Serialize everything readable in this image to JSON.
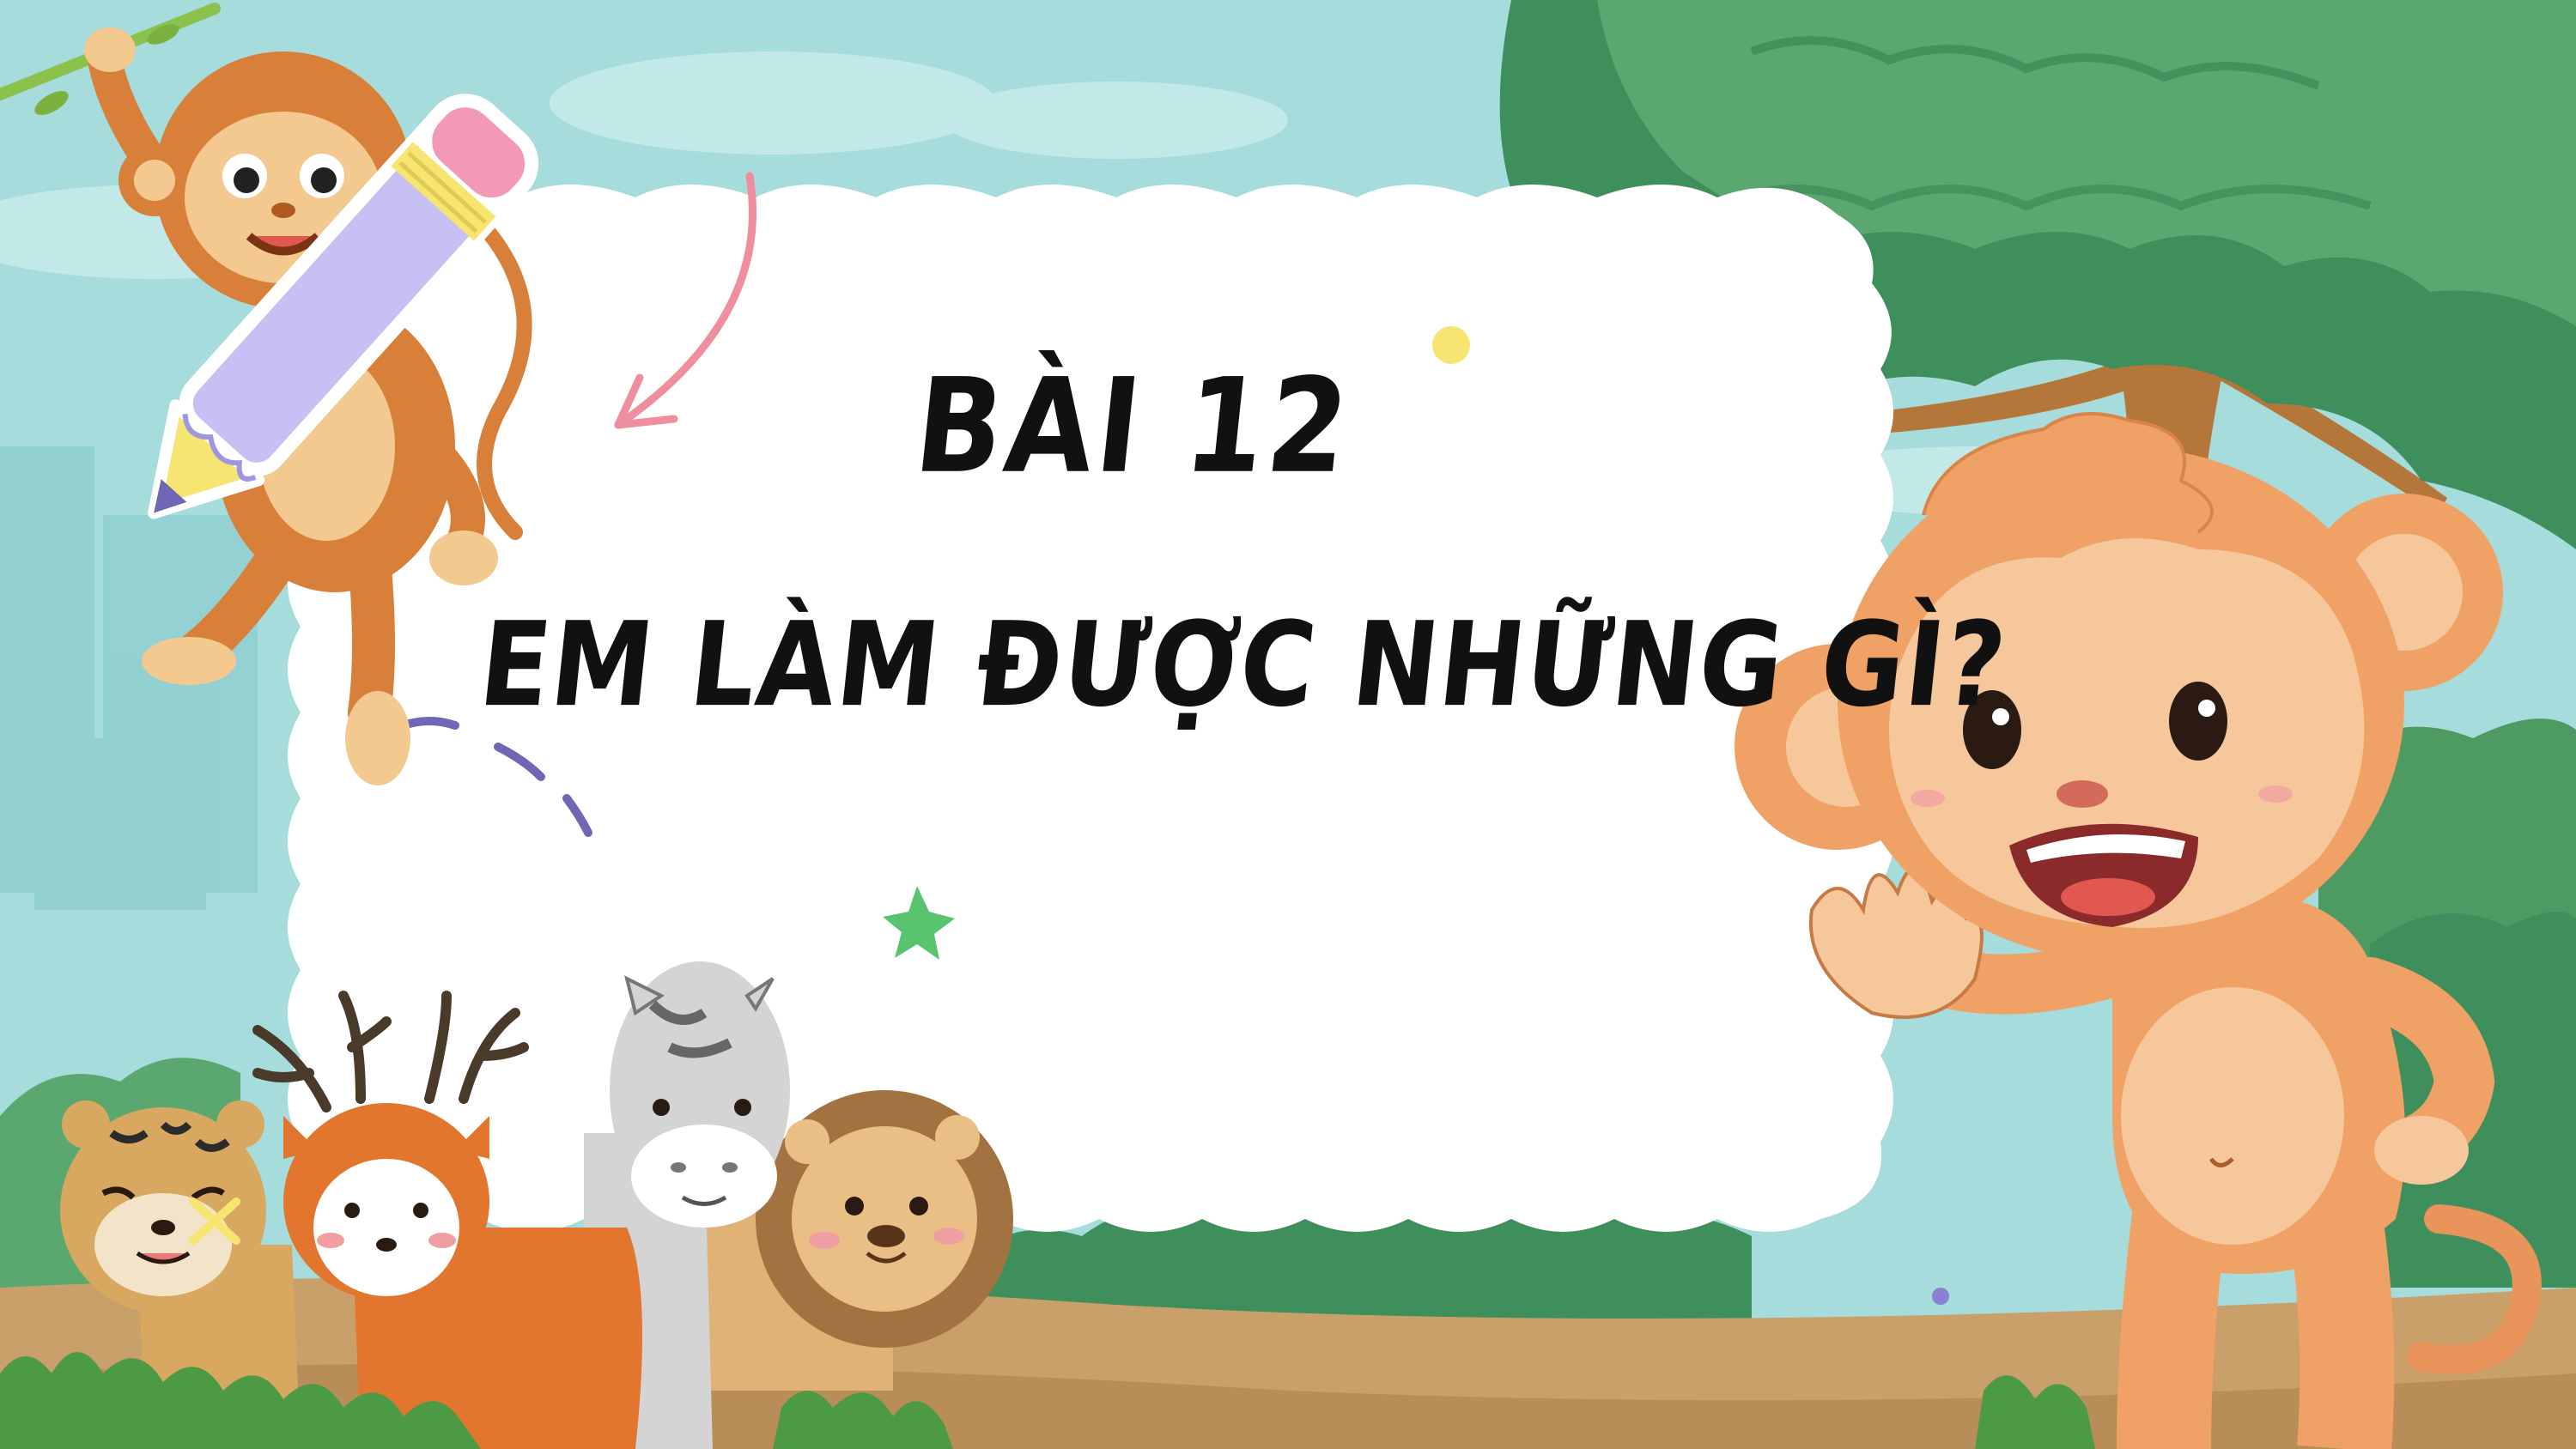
{
  "slide": {
    "lesson_number": "BÀI 12",
    "lesson_title": "EM LÀM ĐƯỢC NHỮNG GÌ?"
  },
  "colors": {
    "sky": "#a6dcdb",
    "tree_dark": "#3f8f5c",
    "tree_light": "#5aa86f",
    "trunk": "#b5763a",
    "ground": "#c9a06a",
    "cloud": "#ffffff",
    "monkey_big": "#f0a266",
    "monkey_small": "#d8803a",
    "pencil": "#c6c0f4",
    "arrow_pink": "#ef8e9e",
    "star_green": "#58c470",
    "dot_yellow": "#f6e571",
    "dash_purple": "#6f66b6"
  },
  "icons": [
    "hanging-monkey-illustration",
    "pencil-icon",
    "curved-arrow-icon",
    "waving-monkey-illustration",
    "tiger-illustration",
    "deer-illustration",
    "zebra-illustration",
    "lion-illustration",
    "star-icon",
    "dot-icon"
  ]
}
